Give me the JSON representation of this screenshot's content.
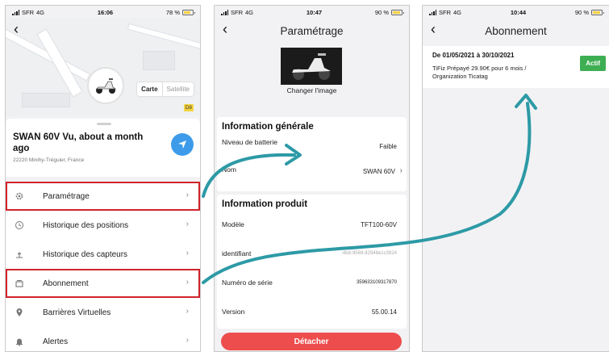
{
  "colors": {
    "accent_red": "#d0242b",
    "arrow": "#2d9aa6",
    "active_green": "#3eae53",
    "detach_red": "#ee4d4d",
    "locate_blue": "#3d9be9"
  },
  "panel1": {
    "status": {
      "carrier": "SFR",
      "network": "4G",
      "time": "16:06",
      "battery": "78 %",
      "battery_level": 0.78
    },
    "back_icon": "chevron-left-icon",
    "map": {
      "type_map": "Carte",
      "type_satellite": "Satellite",
      "road_label": "D8"
    },
    "vehicle": {
      "title": "SWAN 60V Vu, about a month ago",
      "address": "22220 Minihy-Tréguier, France"
    },
    "menu": [
      {
        "label": "Paramétrage",
        "icon": "gear-icon",
        "highlighted": true
      },
      {
        "label": "Historique des positions",
        "icon": "history-icon",
        "highlighted": false
      },
      {
        "label": "Historique des capteurs",
        "icon": "sensor-icon",
        "highlighted": false
      },
      {
        "label": "Abonnement",
        "icon": "subscription-icon",
        "highlighted": true
      },
      {
        "label": "Barrières Virtuelles",
        "icon": "map-pin-icon",
        "highlighted": false
      },
      {
        "label": "Alertes",
        "icon": "bell-icon",
        "highlighted": false
      }
    ]
  },
  "panel2": {
    "status": {
      "carrier": "SFR",
      "network": "4G",
      "time": "10:47",
      "battery": "90 %",
      "battery_level": 0.9
    },
    "title": "Paramétrage",
    "change_image": "Changer l'image",
    "general": {
      "heading": "Information générale",
      "battery_label": "Niveau de batterie",
      "battery_value": "Faible",
      "name_label": "Nom",
      "name_value": "SWAN 60V"
    },
    "product": {
      "heading": "Information produit",
      "model_label": "Modèle",
      "model_value": "TFT100-60V",
      "id_label": "identifiant",
      "id_value": "-4b8-9569-82948e1c3924",
      "serial_label": "Numéro de série",
      "serial_value": "359633109317870",
      "version_label": "Version",
      "version_value": "55.00.14"
    },
    "detach_label": "Détacher"
  },
  "panel3": {
    "status": {
      "carrier": "SFR",
      "network": "4G",
      "time": "10:44",
      "battery": "90 %",
      "battery_level": 0.9
    },
    "title": "Abonnement",
    "subscription": {
      "dates": "De 01/05/2021 à 30/10/2021",
      "description": "TiFiz Prépayé 29.90€ pour 6 mois / Organization Ticatag",
      "status": "Actif"
    }
  }
}
